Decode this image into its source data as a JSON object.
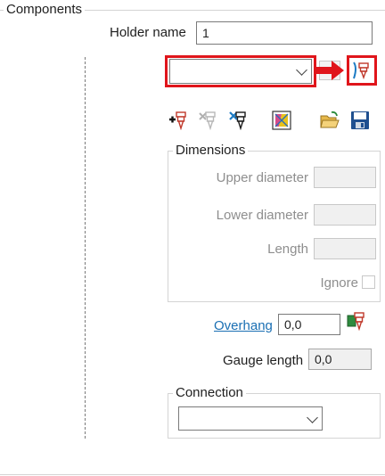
{
  "components": {
    "title": "Components",
    "holder_name_label": "Holder name",
    "holder_name_value": "1"
  },
  "toolbar": {
    "holder_select_value": "",
    "icons": [
      "add-component-icon",
      "delete-component-icon",
      "edit-component-icon",
      "shaded-view-icon",
      "open-folder-icon",
      "save-icon"
    ],
    "highlight_color": "#e0151b"
  },
  "dimensions": {
    "title": "Dimensions",
    "upper_diameter_label": "Upper diameter",
    "lower_diameter_label": "Lower diameter",
    "length_label": "Length",
    "ignore_label": "Ignore"
  },
  "overhang": {
    "label": "Overhang",
    "value": "0,0"
  },
  "gauge": {
    "label": "Gauge length",
    "value": "0,0"
  },
  "connection": {
    "title": "Connection",
    "select_value": ""
  }
}
